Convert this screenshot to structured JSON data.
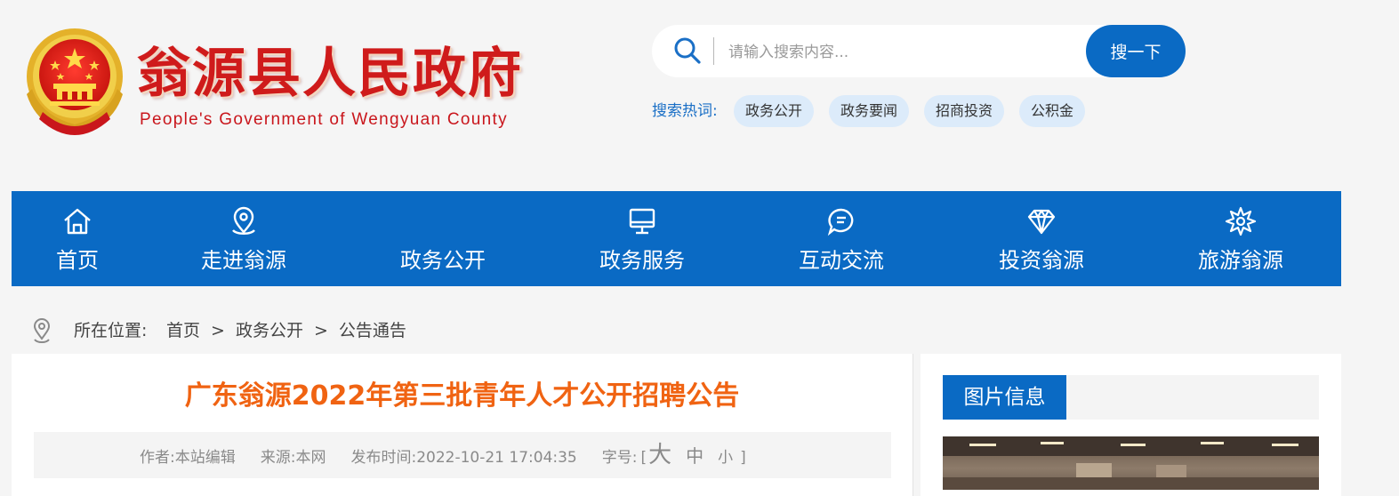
{
  "header": {
    "title": "翁源县人民政府",
    "subtitle": "People's Government of Wengyuan County"
  },
  "search": {
    "placeholder": "请输入搜索内容...",
    "button_label": "搜一下",
    "hot_label": "搜索热词:",
    "hot_tags": [
      "政务公开",
      "政务要闻",
      "招商投资",
      "公积金"
    ]
  },
  "nav": {
    "items": [
      {
        "label": "首页",
        "icon": "home-icon"
      },
      {
        "label": "走进翁源",
        "icon": "location-pin-icon"
      },
      {
        "label": "政务公开",
        "icon": "none"
      },
      {
        "label": "政务服务",
        "icon": "monitor-icon"
      },
      {
        "label": "互动交流",
        "icon": "chat-bubble-icon"
      },
      {
        "label": "投资翁源",
        "icon": "diamond-icon"
      },
      {
        "label": "旅游翁源",
        "icon": "flower-icon"
      }
    ]
  },
  "breadcrumb": {
    "prefix": "所在位置:",
    "items": [
      "首页",
      "政务公开",
      "公告通告"
    ],
    "separator": ">"
  },
  "article": {
    "title": "广东翁源2022年第三批青年人才公开招聘公告",
    "author": "作者:本站编辑",
    "source": "来源:本网",
    "publish_time": "发布时间:2022-10-21 17:04:35",
    "font_size_label": "字号:",
    "bracket_open": "[",
    "font_big": "大",
    "font_mid": "中",
    "font_small": "小",
    "bracket_close": "]"
  },
  "side": {
    "tab_label": "图片信息"
  },
  "colors": {
    "primary_blue": "#0a6ac4",
    "title_red": "#cf1b1b",
    "article_title_orange": "#f06312",
    "hot_tag_bg": "#dcebfa"
  }
}
